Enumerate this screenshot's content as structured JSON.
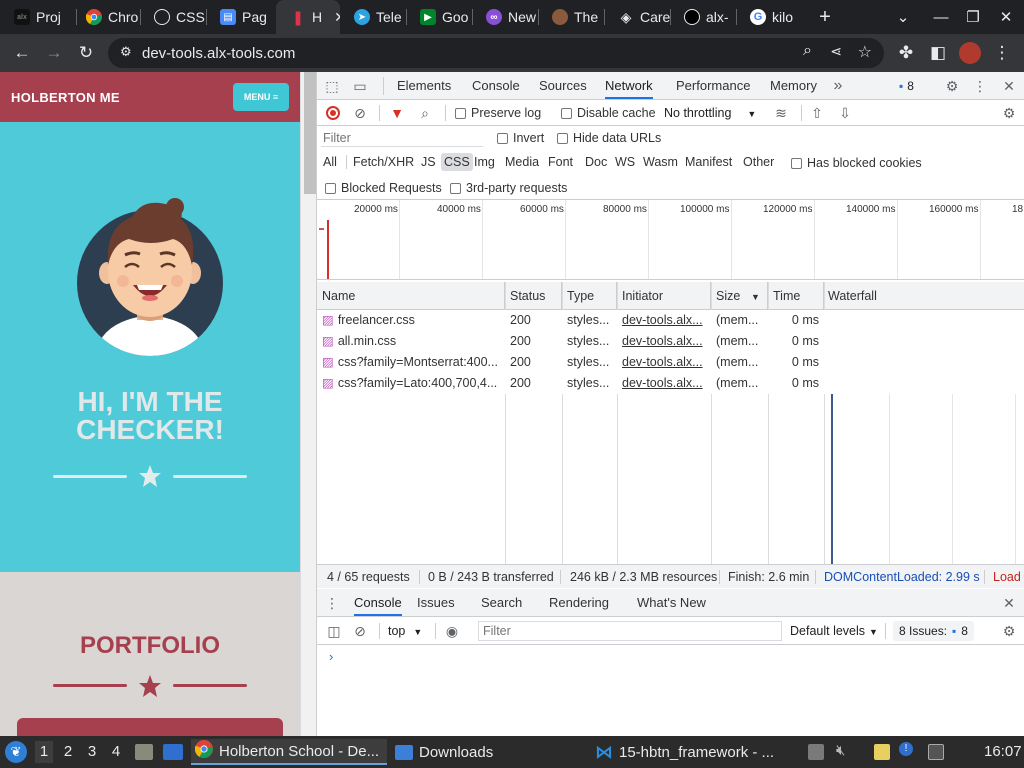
{
  "browser": {
    "tabs": [
      {
        "label": "Proj",
        "icon": "alx-icon"
      },
      {
        "label": "Chro",
        "icon": "chrome-icon"
      },
      {
        "label": "CSS",
        "icon": "chatgpt-icon"
      },
      {
        "label": "Pag",
        "icon": "page-icon"
      },
      {
        "label": "H",
        "icon": "holberton-icon",
        "active": true
      },
      {
        "label": "Tele",
        "icon": "telegram-icon"
      },
      {
        "label": "Goo",
        "icon": "google-meet-icon"
      },
      {
        "label": "New",
        "icon": "new-tab-icon"
      },
      {
        "label": "The",
        "icon": "avatar-icon"
      },
      {
        "label": "Care",
        "icon": "careers-icon"
      },
      {
        "label": "alx-",
        "icon": "github-icon"
      },
      {
        "label": "kilo",
        "icon": "google-icon"
      }
    ],
    "new_tab_glyph": "+",
    "url": "dev-tools.alx-tools.com"
  },
  "webpage": {
    "brand": "HOLBERTON ME",
    "menu_button": "MENU ≡",
    "hero_title_line1": "HI, I'M THE",
    "hero_title_line2": "CHECKER!",
    "portfolio_title": "PORTFOLIO",
    "colors": {
      "nav": "#a6404f",
      "hero": "#4fcad8",
      "accent": "#a6404f"
    }
  },
  "devtools": {
    "main_tabs": [
      "Elements",
      "Console",
      "Sources",
      "Network",
      "Performance",
      "Memory"
    ],
    "active_tab": "Network",
    "issues_badge": "8",
    "network_toolbar": {
      "preserve_log": "Preserve log",
      "disable_cache": "Disable cache",
      "throttling": "No throttling"
    },
    "filter": {
      "placeholder": "Filter",
      "invert": "Invert",
      "hide_data_urls": "Hide data URLs"
    },
    "type_filters": [
      "All",
      "Fetch/XHR",
      "JS",
      "CSS",
      "Img",
      "Media",
      "Font",
      "Doc",
      "WS",
      "Wasm",
      "Manifest",
      "Other"
    ],
    "active_type": "CSS",
    "has_blocked_cookies": "Has blocked cookies",
    "blocked_requests": "Blocked Requests",
    "third_party": "3rd-party requests",
    "timeline_ticks": [
      "20000 ms",
      "40000 ms",
      "60000 ms",
      "80000 ms",
      "100000 ms",
      "120000 ms",
      "140000 ms",
      "160000 ms",
      "18"
    ],
    "columns": [
      "Name",
      "Status",
      "Type",
      "Initiator",
      "Size",
      "Time",
      "Waterfall"
    ],
    "rows": [
      {
        "name": "freelancer.css",
        "status": "200",
        "type": "styles...",
        "initiator": "dev-tools.alx...",
        "size": "(mem...",
        "time": "0 ms"
      },
      {
        "name": "all.min.css",
        "status": "200",
        "type": "styles...",
        "initiator": "dev-tools.alx...",
        "size": "(mem...",
        "time": "0 ms"
      },
      {
        "name": "css?family=Montserrat:400...",
        "status": "200",
        "type": "styles...",
        "initiator": "dev-tools.alx...",
        "size": "(mem...",
        "time": "0 ms"
      },
      {
        "name": "css?family=Lato:400,700,4...",
        "status": "200",
        "type": "styles...",
        "initiator": "dev-tools.alx...",
        "size": "(mem...",
        "time": "0 ms"
      }
    ],
    "summary": {
      "requests": "4 / 65 requests",
      "transferred": "0 B / 243 B transferred",
      "resources": "246 kB / 2.3 MB resources",
      "finish": "Finish: 2.6 min",
      "dcl": "DOMContentLoaded: 2.99 s",
      "load": "Load"
    },
    "drawer_tabs": [
      "Console",
      "Issues",
      "Search",
      "Rendering",
      "What's New"
    ],
    "drawer_active": "Console",
    "console": {
      "context": "top",
      "filter_placeholder": "Filter",
      "levels": "Default levels",
      "issues_label": "8 Issues:",
      "issues_count": "8"
    }
  },
  "taskbar": {
    "workspaces": [
      "1",
      "2",
      "3",
      "4"
    ],
    "tasks": [
      {
        "label": "Holberton School - De...",
        "icon": "chrome-icon",
        "active": true
      },
      {
        "label": "Downloads",
        "icon": "folder-icon",
        "active": false
      },
      {
        "label": "15-hbtn_framework - ...",
        "icon": "vscode-icon",
        "active": false
      }
    ],
    "clock": "16:07"
  }
}
